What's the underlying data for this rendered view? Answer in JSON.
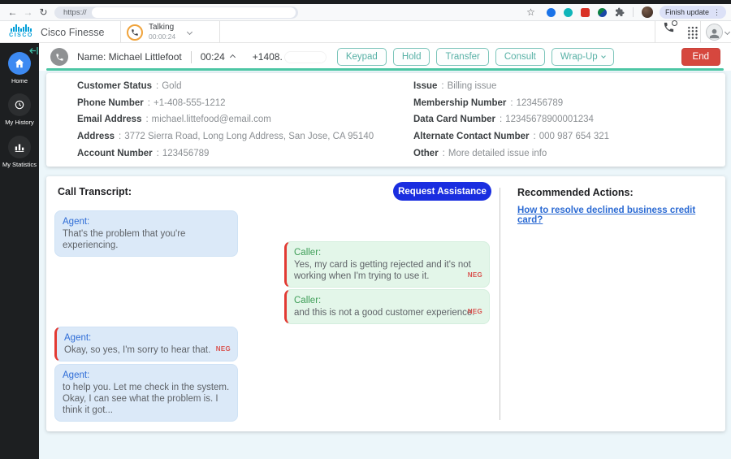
{
  "browser": {
    "url": "https://",
    "update_label": "Finish update",
    "menu_icon": "⋮"
  },
  "header": {
    "brand": "cisco",
    "app_title": "Cisco Finesse",
    "state_label": "Talking",
    "state_timer": "00:00:24"
  },
  "sidebar": {
    "items": [
      {
        "label": "Home"
      },
      {
        "label": "My History"
      },
      {
        "label": "My Statistics"
      }
    ]
  },
  "call_bar": {
    "name_label": "Name: Michael Littlefoot",
    "timer": "00:24",
    "phone_number": "+1408.",
    "buttons": {
      "keypad": "Keypad",
      "hold": "Hold",
      "transfer": "Transfer",
      "consult": "Consult",
      "wrapup": "Wrap-Up",
      "end": "End"
    }
  },
  "customer": {
    "separator": ":",
    "left": [
      {
        "label": "Customer Status",
        "value": "Gold"
      },
      {
        "label": "Phone Number",
        "value": "+1-408-555-1212"
      },
      {
        "label": "Email Address",
        "value": "michael.littefood@email.com"
      },
      {
        "label": "Address",
        "value": "3772 Sierra Road, Long Long Address, San Jose, CA 95140"
      },
      {
        "label": "Account Number",
        "value": "123456789"
      }
    ],
    "right": [
      {
        "label": "Issue",
        "value": "Billing issue"
      },
      {
        "label": "Membership Number",
        "value": "123456789"
      },
      {
        "label": "Data Card Number",
        "value": "12345678900001234"
      },
      {
        "label": "Alternate Contact Number",
        "value": "000 987 654 321"
      },
      {
        "label": "Other",
        "value": "More detailed issue info"
      }
    ]
  },
  "transcript": {
    "title": "Call Transcript:",
    "request_assistance_label": "Request Assistance",
    "messages": [
      {
        "speaker": "Agent:",
        "text": "That's the problem that you're experiencing.",
        "sentiment": ""
      },
      {
        "speaker": "Caller:",
        "text": "Yes, my card is getting rejected and it's not working when I'm trying to use it.",
        "sentiment": "NEG"
      },
      {
        "speaker": "Caller:",
        "text": "and this is not a good customer experience.",
        "sentiment": "NEG"
      },
      {
        "speaker": "Agent:",
        "text": "Okay, so yes, I'm sorry to hear that.",
        "sentiment": "NEG"
      },
      {
        "speaker": "Agent:",
        "text": "to help you. Let me check in the system. Okay, I can see what the problem is. I think it got...",
        "sentiment": ""
      }
    ]
  },
  "recommended": {
    "title": "Recommended Actions:",
    "link_label": "How to resolve declined business credit card?"
  },
  "colors": {
    "accent_teal": "#4cc6a4",
    "end_red": "#d6473e",
    "assist_blue": "#1a2ee0",
    "cisco_blue": "#049fd9",
    "home_blue": "#3d8af2",
    "neg_red": "#d9534f",
    "link_blue": "#2b6ad3",
    "agent_bubble": "#dbe9f8",
    "caller_bubble": "#e3f6e9"
  }
}
